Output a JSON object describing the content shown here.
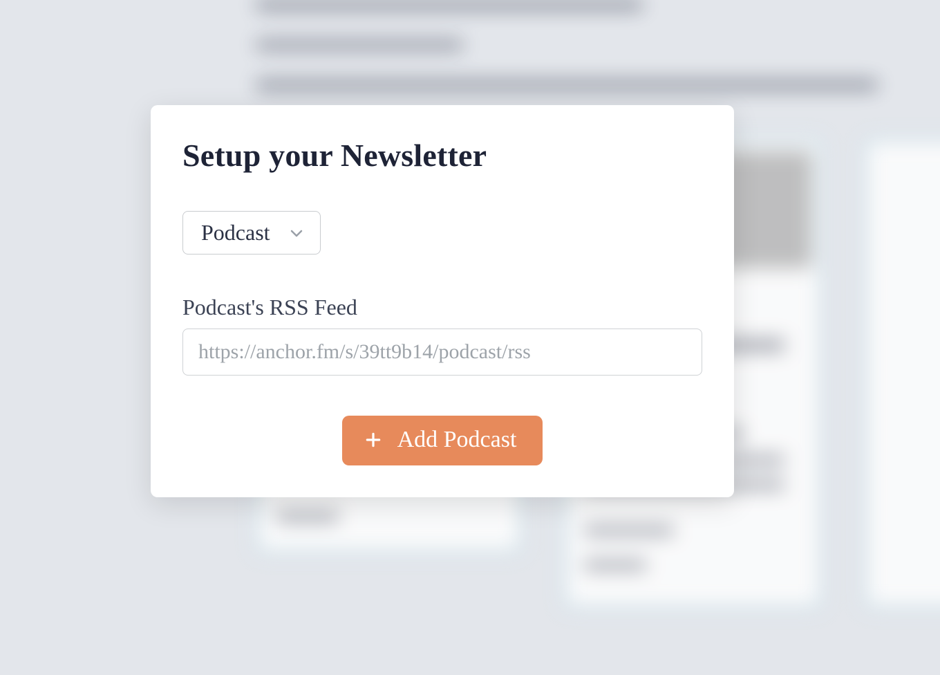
{
  "modal": {
    "title": "Setup your Newsletter",
    "source_select": {
      "value": "Podcast"
    },
    "rss": {
      "label": "Podcast's RSS Feed",
      "placeholder": "https://anchor.fm/s/39tt9b14/podcast/rss",
      "value": ""
    },
    "add_button_label": "Add Podcast"
  }
}
